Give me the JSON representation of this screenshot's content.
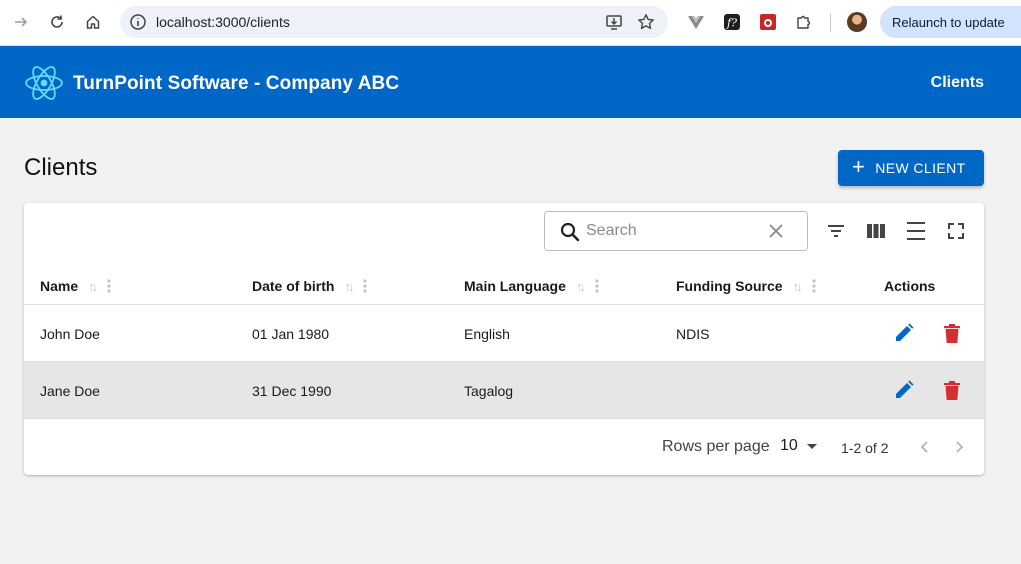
{
  "browser": {
    "url": "localhost:3000/clients",
    "relaunch_label": "Relaunch to update"
  },
  "appbar": {
    "brand": "TurnPoint Software - Company ABC",
    "nav_item": "Clients",
    "logo_icon": "react-logo-icon"
  },
  "page": {
    "title": "Clients",
    "new_button_label": "NEW CLIENT"
  },
  "toolbar": {
    "search_placeholder": "Search",
    "search_value": ""
  },
  "table": {
    "columns": [
      "Name",
      "Date of birth",
      "Main Language",
      "Funding Source",
      "Actions"
    ],
    "rows": [
      {
        "name": "John Doe",
        "dob": "01 Jan 1980",
        "language": "English",
        "funding": "NDIS"
      },
      {
        "name": "Jane Doe",
        "dob": "31 Dec 1990",
        "language": "Tagalog",
        "funding": ""
      }
    ]
  },
  "pagination": {
    "rows_per_page_label": "Rows per page",
    "rows_per_page_value": "10",
    "range": "1-2 of 2"
  },
  "colors": {
    "primary": "#0067c6",
    "edit": "#0067c6",
    "delete": "#d32f2f",
    "row_alt": "#e6e6e6"
  }
}
